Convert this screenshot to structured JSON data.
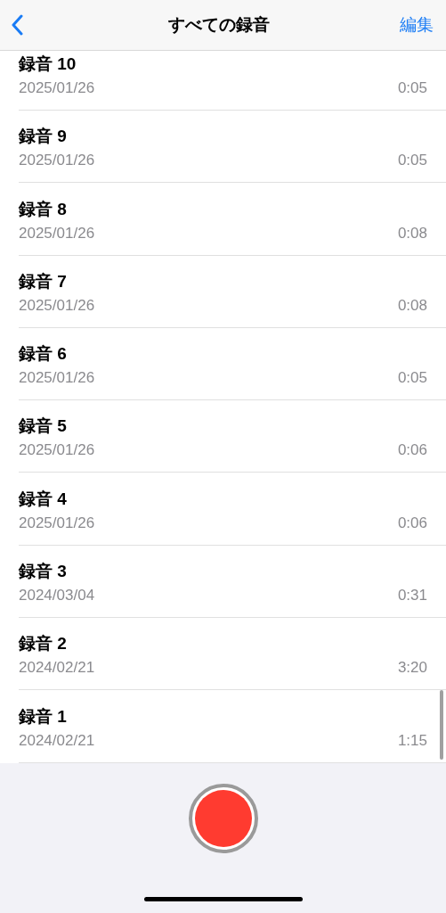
{
  "nav": {
    "title": "すべての録音",
    "action": "編集"
  },
  "recordings": [
    {
      "title": "録音 10",
      "date": "2025/01/26",
      "duration": "0:05"
    },
    {
      "title": "録音 9",
      "date": "2025/01/26",
      "duration": "0:05"
    },
    {
      "title": "録音 8",
      "date": "2025/01/26",
      "duration": "0:08"
    },
    {
      "title": "録音 7",
      "date": "2025/01/26",
      "duration": "0:08"
    },
    {
      "title": "録音 6",
      "date": "2025/01/26",
      "duration": "0:05"
    },
    {
      "title": "録音 5",
      "date": "2025/01/26",
      "duration": "0:06"
    },
    {
      "title": "録音 4",
      "date": "2025/01/26",
      "duration": "0:06"
    },
    {
      "title": "録音 3",
      "date": "2024/03/04",
      "duration": "0:31"
    },
    {
      "title": "録音 2",
      "date": "2024/02/21",
      "duration": "3:20"
    },
    {
      "title": "録音 1",
      "date": "2024/02/21",
      "duration": "1:15"
    }
  ]
}
